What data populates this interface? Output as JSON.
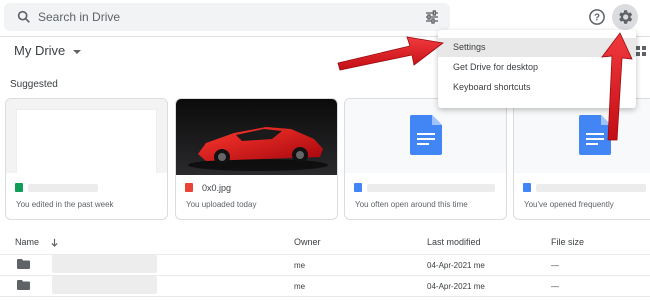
{
  "search": {
    "placeholder": "Search in Drive"
  },
  "header": {
    "title": "My Drive"
  },
  "suggested": {
    "label": "Suggested",
    "cards": [
      {
        "name": "",
        "sub": "You edited in the past week",
        "file_color": "#0f9d58"
      },
      {
        "name": "0x0.jpg",
        "sub": "You uploaded today",
        "file_color": "#ea4335"
      },
      {
        "name": "",
        "sub": "You often open around this time",
        "file_color": "#4285f4"
      },
      {
        "name": "",
        "sub": "You've opened frequently",
        "file_color": "#4285f4"
      }
    ]
  },
  "files": {
    "columns": [
      "Name",
      "Owner",
      "Last modified",
      "File size"
    ],
    "rows": [
      {
        "owner": "me",
        "modified": "04-Apr-2021 me",
        "size": "—"
      },
      {
        "owner": "me",
        "modified": "04-Apr-2021 me",
        "size": "—"
      }
    ]
  },
  "settings_menu": {
    "items": [
      "Settings",
      "Get Drive for desktop",
      "Keyboard shortcuts"
    ],
    "selected": "Settings"
  },
  "icons": [
    "search-icon",
    "tune-icon",
    "help-icon",
    "gear-icon",
    "grid-view-icon",
    "folder-icon",
    "doc-icon",
    "sort-arrow-icon"
  ],
  "colors": {
    "accent_blue": "#4285f4",
    "annotation_red": "#e0161c",
    "menu_highlight": "#e8e8e8"
  }
}
